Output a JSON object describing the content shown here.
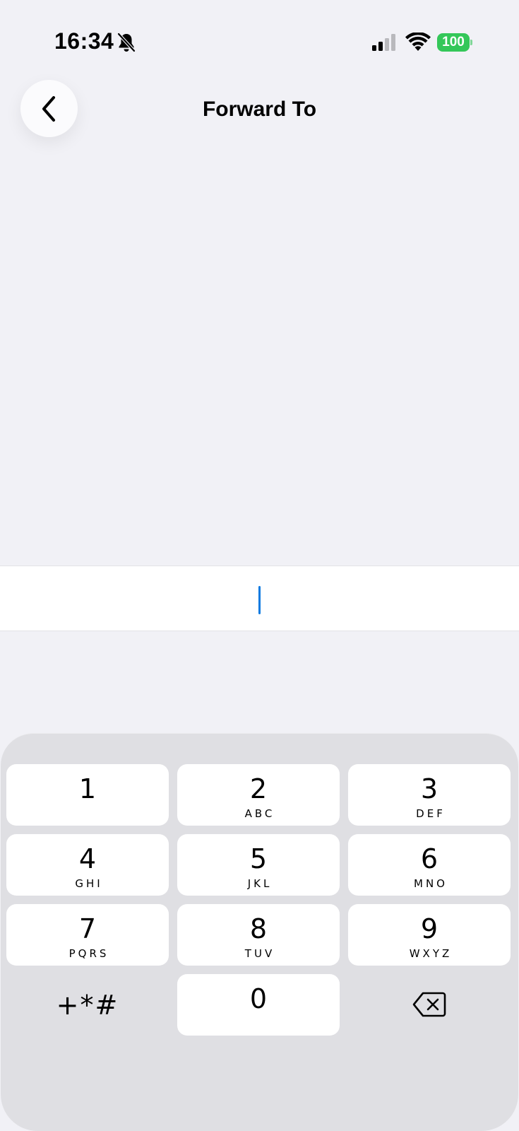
{
  "status_bar": {
    "time": "16:34",
    "battery": "100",
    "icons": [
      "bell-slash-icon",
      "cellular-signal-icon",
      "wifi-icon",
      "battery-icon"
    ],
    "battery_color": "#34c759"
  },
  "header": {
    "title": "Forward To",
    "back_icon": "chevron-left-icon"
  },
  "number_field": {
    "value": "",
    "caret_color": "#0a7ae0"
  },
  "keypad": {
    "keys": [
      {
        "digit": "1",
        "letters": ""
      },
      {
        "digit": "2",
        "letters": "ABC"
      },
      {
        "digit": "3",
        "letters": "DEF"
      },
      {
        "digit": "4",
        "letters": "GHI"
      },
      {
        "digit": "5",
        "letters": "JKL"
      },
      {
        "digit": "6",
        "letters": "MNO"
      },
      {
        "digit": "7",
        "letters": "PQRS"
      },
      {
        "digit": "8",
        "letters": "TUV"
      },
      {
        "digit": "9",
        "letters": "WXYZ"
      },
      {
        "digit": "0",
        "letters": ""
      }
    ],
    "symbols_label": "+*#",
    "delete_icon": "delete-backspace-icon"
  }
}
